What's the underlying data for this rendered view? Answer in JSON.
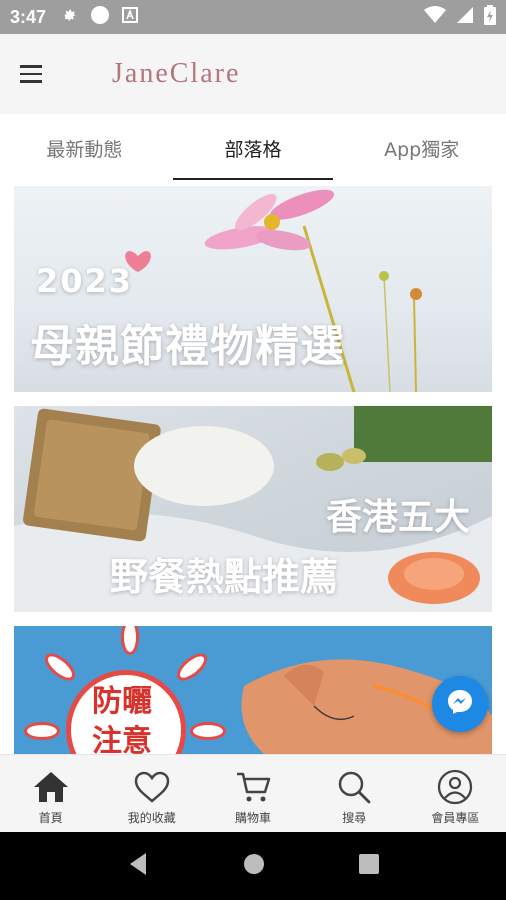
{
  "status_bar": {
    "time": "3:47",
    "icons": [
      "gear-icon",
      "circle-icon",
      "font-a-icon",
      "wifi-icon",
      "signal-icon",
      "battery-icon"
    ]
  },
  "header": {
    "brand": "JaneClare",
    "menu_icon": "hamburger-icon"
  },
  "tabs": [
    {
      "label": "最新動態",
      "active": false
    },
    {
      "label": "部落格",
      "active": true
    },
    {
      "label": "App獨家",
      "active": false
    }
  ],
  "cards": [
    {
      "year": "2023",
      "title": "母親節禮物精選"
    },
    {
      "line1": "香港五大",
      "line2": "野餐熱點推薦"
    },
    {
      "title": "防曬注意"
    }
  ],
  "floating": {
    "icon": "messenger-icon"
  },
  "bottom_nav": [
    {
      "label": "首頁",
      "icon": "home-icon",
      "active": true
    },
    {
      "label": "我的收藏",
      "icon": "heart-icon",
      "active": false
    },
    {
      "label": "購物車",
      "icon": "cart-icon",
      "active": false
    },
    {
      "label": "搜尋",
      "icon": "search-icon",
      "active": false
    },
    {
      "label": "會員專區",
      "icon": "user-icon",
      "active": false
    }
  ],
  "system_nav": [
    "back-icon",
    "home-circle-icon",
    "recents-icon"
  ],
  "colors": {
    "brand": "#b5757a",
    "status_bar": "#9e9e9e",
    "messenger": "#1e88e5",
    "accent_red": "#e74a44"
  }
}
